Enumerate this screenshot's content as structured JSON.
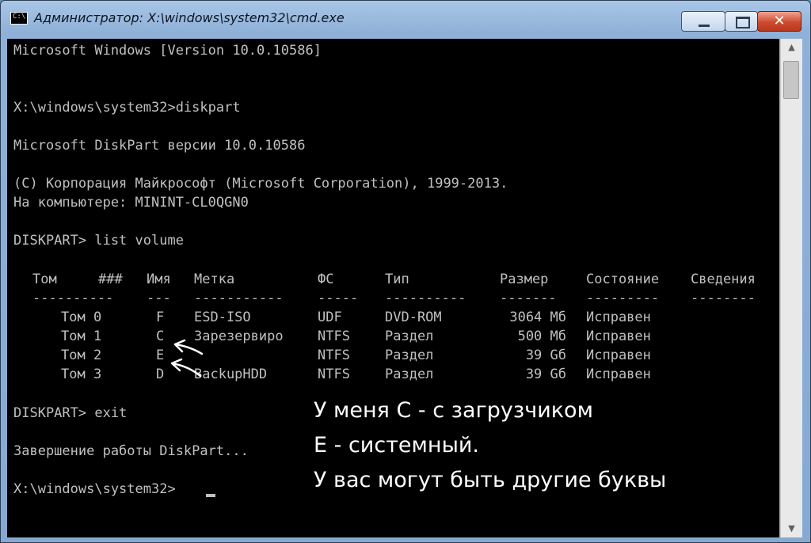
{
  "window": {
    "title": "Администратор: X:\\windows\\system32\\cmd.exe",
    "icon_text": "C:\\",
    "minimize_icon": "minimize-icon",
    "maximize_icon": "maximize-icon",
    "close_glyph": "✕"
  },
  "console": {
    "header_version": "Microsoft Windows [Version 10.0.10586]",
    "cmd_diskpart": "X:\\windows\\system32>diskpart",
    "diskpart_version": "Microsoft DiskPart версии 10.0.10586",
    "copyright": "(C) Корпорация Майкрософт (Microsoft Corporation), 1999-2013.",
    "computer": "На компьютере: MININT-CL0QGN0",
    "cmd_list": "DISKPART> list volume",
    "table": {
      "headers": [
        "Том",
        "###",
        "Имя",
        "Метка",
        "ФС",
        "Тип",
        "Размер",
        "Состояние",
        "Сведения"
      ],
      "separators": [
        "----------",
        "---",
        "-----------",
        "-----",
        "----------",
        "-------",
        "---------",
        "--------"
      ],
      "rows": [
        {
          "vol": "Том 0",
          "letter": "F",
          "label": "ESD-ISO",
          "fs": "UDF",
          "type": "DVD-ROM",
          "size": "3064 Мб",
          "status": "Исправен"
        },
        {
          "vol": "Том 1",
          "letter": "C",
          "label": "Зарезервиро",
          "fs": "NTFS",
          "type": "Раздел",
          "size": "500 Мб",
          "status": "Исправен"
        },
        {
          "vol": "Том 2",
          "letter": "E",
          "label": "",
          "fs": "NTFS",
          "type": "Раздел",
          "size": "39 Gб",
          "status": "Исправен"
        },
        {
          "vol": "Том 3",
          "letter": "D",
          "label": "BackupHDD",
          "fs": "NTFS",
          "type": "Раздел",
          "size": "39 Gб",
          "status": "Исправен"
        }
      ]
    },
    "cmd_exit": "DISKPART> exit",
    "exit_msg": "Завершение работы DiskPart...",
    "prompt": "X:\\windows\\system32>"
  },
  "annotation": {
    "line1": "У меня С - с загрузчиком",
    "line2": "Е - системный.",
    "line3": "У вас могут быть другие буквы",
    "color": "#ffffff"
  },
  "colors": {
    "console_bg": "#000000",
    "console_text": "#c0c0c0",
    "close_button": "#cc4a2e"
  }
}
